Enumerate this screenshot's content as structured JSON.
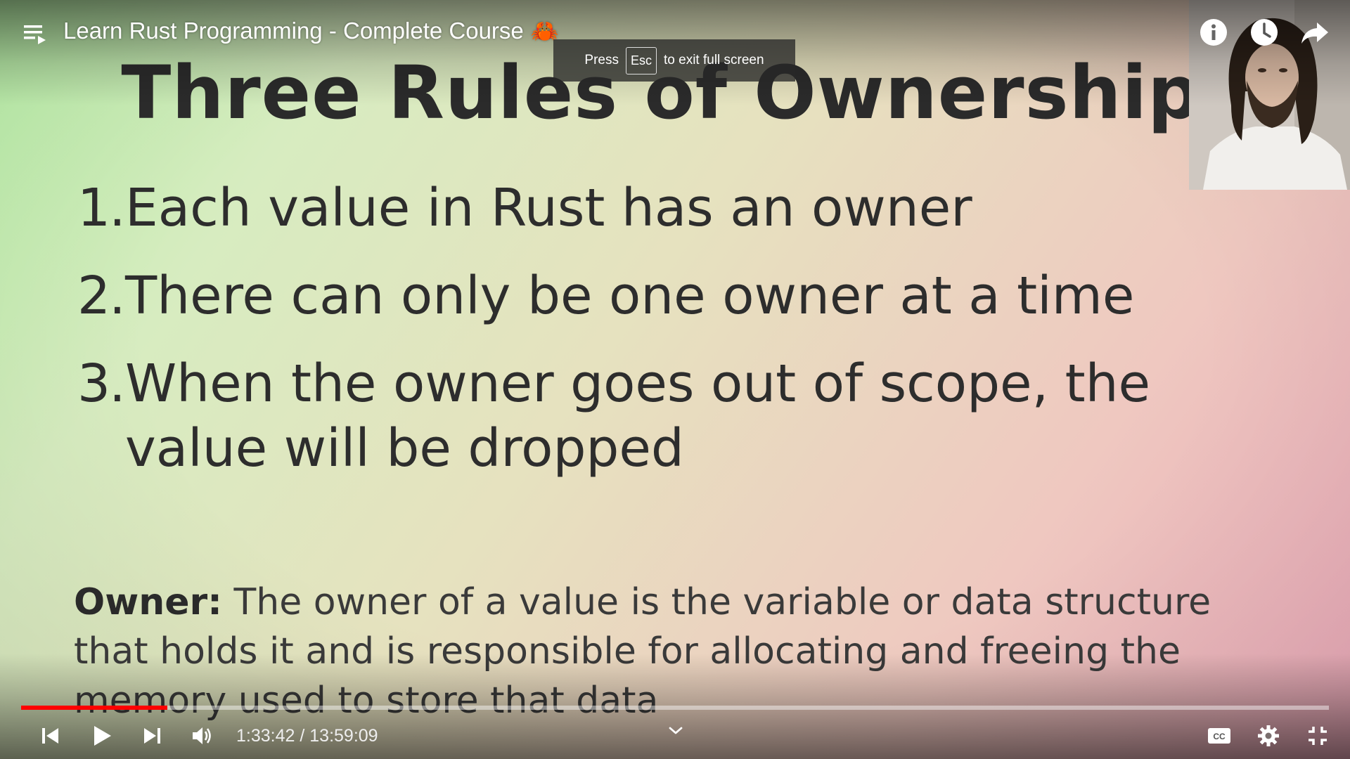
{
  "header": {
    "title": "Learn Rust Programming - Complete Course",
    "title_emoji": "🦀"
  },
  "esc_toast": {
    "press": "Press",
    "key": "Esc",
    "message": "to exit full screen"
  },
  "slide": {
    "title": "Three Rules of Ownership",
    "rules": [
      {
        "num": "1.",
        "text": "Each value in Rust has an owner"
      },
      {
        "num": "2.",
        "text": "There can only be one owner at a time"
      },
      {
        "num": "3.",
        "text": "When the owner goes out of scope, the value will be dropped"
      }
    ],
    "definition_term": "Owner:",
    "definition_text": " The owner of a value is the variable or data structure that holds it and is responsible for allocating and freeing the memory used to store that data"
  },
  "controls": {
    "current_time": "1:33:42",
    "separator": " / ",
    "duration": "13:59:09",
    "progress_fraction": 0.1117,
    "buffer_fraction": 0.1117
  },
  "colors": {
    "progress_played": "#ff0000",
    "title_text": "#ffffff"
  },
  "icons": {
    "playlist": "playlist-icon",
    "info": "info-icon",
    "watch_later": "clock-icon",
    "share": "share-icon",
    "previous": "skip-previous-icon",
    "play": "play-icon",
    "next": "skip-next-icon",
    "volume": "volume-icon",
    "chevron": "chevron-down-icon",
    "captions": "captions-icon",
    "settings": "gear-icon",
    "exit_fullscreen": "exit-fullscreen-icon"
  }
}
